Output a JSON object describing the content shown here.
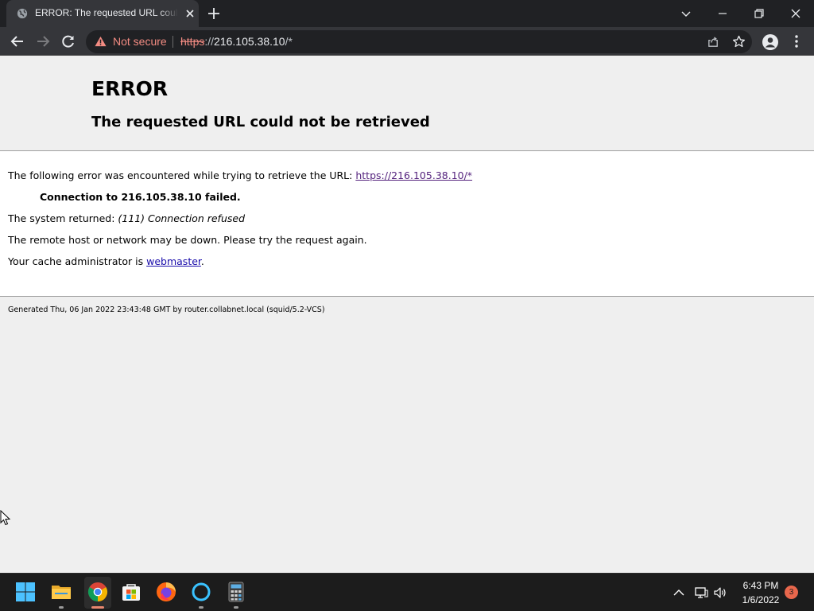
{
  "browser": {
    "tab_title": "ERROR: The requested URL could not be retrieved",
    "address": {
      "security_label": "Not secure",
      "url_scheme": "https",
      "url_rest": "://",
      "url_host": "216.105.38.10",
      "url_path": "/*"
    },
    "colors": {
      "frame": "#202124",
      "toolbar": "#35363a",
      "warning": "#f28b82"
    }
  },
  "page": {
    "title": "ERROR",
    "subtitle": "The requested URL could not be retrieved",
    "intro_text": "The following error was encountered while trying to retrieve the URL: ",
    "intro_link": "https://216.105.38.10/*",
    "detail": "Connection to 216.105.38.10 failed.",
    "system_returned_label": "The system returned: ",
    "system_returned_value": "(111) Connection refused",
    "remote_host_text": "The remote host or network may be down. Please try the request again.",
    "cache_admin_text": "Your cache administrator is ",
    "cache_admin_link": "webmaster",
    "cache_admin_suffix": ".",
    "footer": "Generated Thu, 06 Jan 2022 23:43:48 GMT by router.collabnet.local (squid/5.2-VCS)"
  },
  "taskbar": {
    "apps": [
      "start-icon",
      "file-explorer-icon",
      "chrome-icon",
      "store-icon",
      "firefox-icon",
      "cortana-icon",
      "calculator-icon"
    ],
    "time": "6:43 PM",
    "date": "1/6/2022",
    "notification_count": "3"
  }
}
